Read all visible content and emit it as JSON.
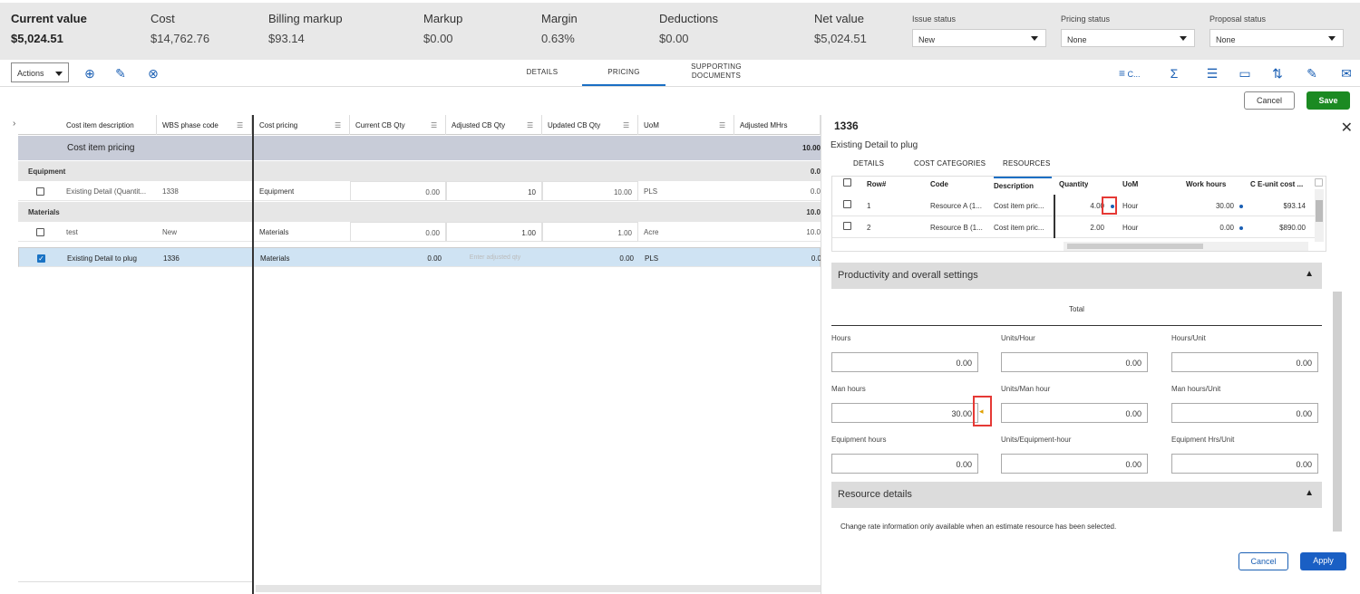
{
  "summary": [
    {
      "label": "Current value",
      "value": "$5,024.51"
    },
    {
      "label": "Cost",
      "value": "$14,762.76"
    },
    {
      "label": "Billing markup",
      "value": "$93.14"
    },
    {
      "label": "Markup",
      "value": "$0.00"
    },
    {
      "label": "Margin",
      "value": "0.63%"
    },
    {
      "label": "Deductions",
      "value": "$0.00"
    },
    {
      "label": "Net value",
      "value": "$5,024.51"
    }
  ],
  "status": [
    {
      "label": "Issue status",
      "value": "New"
    },
    {
      "label": "Pricing status",
      "value": "None"
    },
    {
      "label": "Proposal status",
      "value": "None"
    }
  ],
  "toolbar": {
    "actions": "Actions",
    "tabs": [
      "DETAILS",
      "PRICING",
      "SUPPORTING",
      "DOCUMENTS"
    ],
    "filter_label": "C...",
    "cancel": "Cancel",
    "save": "Save"
  },
  "grid": {
    "left_headers": [
      "Cost item description",
      "WBS phase code"
    ],
    "right_headers": [
      "Cost pricing",
      "Current CB Qty",
      "Adjusted CB Qty",
      "Updated CB Qty",
      "UoM",
      "Adjusted MHrs"
    ],
    "band": {
      "label": "Cost item pricing",
      "mhrs": "10.00"
    },
    "groups": {
      "equipment": {
        "label": "Equipment",
        "mhrs": "0.0"
      },
      "materials": {
        "label": "Materials",
        "mhrs": "10.0"
      }
    },
    "rows": [
      {
        "desc": "Existing Detail (Quantit...",
        "wbs": "1338",
        "pricing": "Equipment",
        "cur": "0.00",
        "adj": "10",
        "upd": "10.00",
        "uom": "PLS",
        "mhrs": "0.0"
      },
      {
        "desc": "test",
        "wbs": "New",
        "pricing": "Materials",
        "cur": "0.00",
        "adj": "1.00",
        "upd": "1.00",
        "uom": "Acre",
        "mhrs": "10.0"
      },
      {
        "desc": "Existing Detail to plug",
        "wbs": "1336",
        "pricing": "Materials",
        "cur": "0.00",
        "adj_placeholder": "Enter adjusted qty",
        "upd": "0.00",
        "uom": "PLS",
        "mhrs": "0.0"
      }
    ]
  },
  "panel": {
    "title": "1336",
    "subtitle": "Existing Detail to plug",
    "tabs": [
      "DETAILS",
      "COST CATEGORIES",
      "RESOURCES"
    ],
    "res_headers": [
      "Row#",
      "Code",
      "Description",
      "Quantity",
      "UoM",
      "Work hours",
      "C E-unit cost ..."
    ],
    "res_rows": [
      {
        "row": "1",
        "code": "Resource A (1...",
        "desc": "Cost item pric...",
        "qty": "4.00",
        "uom": "Hour",
        "hours": "30.00",
        "cost": "$93.14"
      },
      {
        "row": "2",
        "code": "Resource B (1...",
        "desc": "Cost item pric...",
        "qty": "2.00",
        "uom": "Hour",
        "hours": "0.00",
        "cost": "$890.00"
      }
    ],
    "productivity": {
      "title": "Productivity and overall settings",
      "total": "Total",
      "fields": [
        {
          "label": "Hours",
          "value": "0.00"
        },
        {
          "label": "Units/Hour",
          "value": "0.00"
        },
        {
          "label": "Hours/Unit",
          "value": "0.00"
        },
        {
          "label": "Man hours",
          "value": "30.00"
        },
        {
          "label": "Units/Man hour",
          "value": "0.00"
        },
        {
          "label": "Man hours/Unit",
          "value": "0.00"
        },
        {
          "label": "Equipment hours",
          "value": "0.00"
        },
        {
          "label": "Units/Equipment-hour",
          "value": "0.00"
        },
        {
          "label": "Equipment Hrs/Unit",
          "value": "0.00"
        }
      ]
    },
    "resource_details": {
      "title": "Resource details",
      "note": "Change rate information only available when an estimate resource has been selected."
    },
    "cancel": "Cancel",
    "apply": "Apply"
  },
  "colors": {
    "accent": "#1a5fb4",
    "save": "#1b8a22",
    "selected_row": "#cfe3f3",
    "highlight": "#e53935"
  }
}
